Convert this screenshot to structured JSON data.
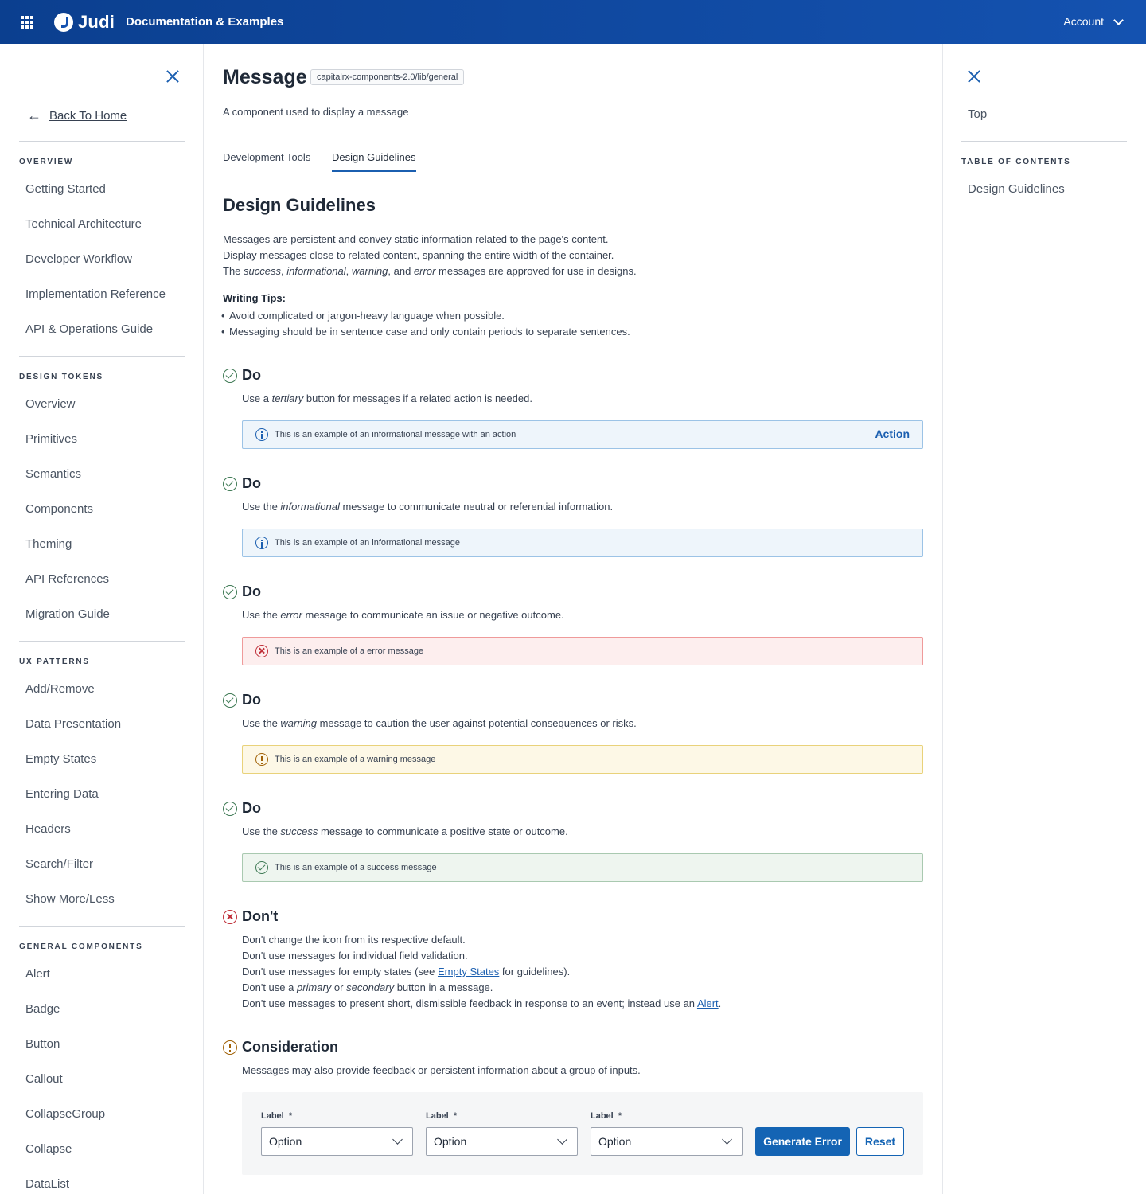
{
  "header": {
    "logo_text": "Judi",
    "app_title": "Documentation & Examples",
    "account_label": "Account"
  },
  "sidebar": {
    "back_label": "Back To Home",
    "sections": [
      {
        "title": "OVERVIEW",
        "items": [
          "Getting Started",
          "Technical Architecture",
          "Developer Workflow",
          "Implementation Reference",
          "API & Operations Guide"
        ]
      },
      {
        "title": "DESIGN TOKENS",
        "items": [
          "Overview",
          "Primitives",
          "Semantics",
          "Components",
          "Theming",
          "API References",
          "Migration Guide"
        ]
      },
      {
        "title": "UX PATTERNS",
        "items": [
          "Add/Remove",
          "Data Presentation",
          "Empty States",
          "Entering Data",
          "Headers",
          "Search/Filter",
          "Show More/Less"
        ]
      },
      {
        "title": "GENERAL COMPONENTS",
        "items": [
          "Alert",
          "Badge",
          "Button",
          "Callout",
          "CollapseGroup",
          "Collapse",
          "DataList"
        ]
      }
    ]
  },
  "page": {
    "title": "Message",
    "path_badge": "capitalrx-components-2.0/lib/general",
    "description": "A component used to display a message",
    "tabs": [
      "Development Tools",
      "Design Guidelines"
    ],
    "active_tab": "Design Guidelines"
  },
  "guidelines": {
    "heading": "Design Guidelines",
    "intro_line1": "Messages are persistent and convey static information related to the page's content.",
    "intro_line2": "Display messages close to related content, spanning the entire width of the container.",
    "intro_line3_prefix": "The ",
    "intro_line3_success": "success",
    "intro_line3_sep1": ", ",
    "intro_line3_info": "informational",
    "intro_line3_sep2": ", ",
    "intro_line3_warning": "warning",
    "intro_line3_sep3": ", and ",
    "intro_line3_error": "error",
    "intro_line3_suffix": " messages are approved for use in designs.",
    "tips_title": "Writing Tips:",
    "tips": [
      "Avoid complicated or jargon-heavy language when possible.",
      "Messaging should be in sentence case and only contain periods to separate sentences."
    ],
    "do_label": "Do",
    "dos": [
      {
        "pre": "Use a ",
        "em": "tertiary",
        "post": " button for messages if a related action is needed.",
        "message": "This is an example of an informational message with an action",
        "action": "Action"
      },
      {
        "pre": "Use the ",
        "em": "informational",
        "post": " message to communicate neutral or referential information.",
        "message": "This is an example of an informational message"
      },
      {
        "pre": "Use the ",
        "em": "error",
        "post": " message to communicate an issue or negative outcome.",
        "message": "This is an example of a error message"
      },
      {
        "pre": "Use the ",
        "em": "warning",
        "post": " message to caution the user against potential consequences or risks.",
        "message": "This is an example of a warning message"
      },
      {
        "pre": "Use the ",
        "em": "success",
        "post": " message to communicate a positive state or outcome.",
        "message": "This is an example of a success message"
      }
    ],
    "dont_label": "Don't",
    "donts": {
      "line1": "Don't change the icon from its respective default.",
      "line2": "Don't use messages for individual field validation.",
      "line3_pre": "Don't use messages for empty states (see ",
      "line3_link": "Empty States",
      "line3_post": " for guidelines).",
      "line4_pre": "Don't use a ",
      "line4_em1": "primary",
      "line4_mid": " or ",
      "line4_em2": "secondary",
      "line4_post": " button in a message.",
      "line5_pre": "Don't use messages to present short, dismissible feedback in response to an event; instead use an ",
      "line5_link": "Alert",
      "line5_post": "."
    },
    "consideration_label": "Consideration",
    "consideration_desc": "Messages may also provide feedback or persistent information about a group of inputs.",
    "demo": {
      "field_label": "Label",
      "required_mark": "*",
      "select_value": "Option",
      "generate_label": "Generate Error",
      "reset_label": "Reset"
    }
  },
  "toc": {
    "top_label": "Top",
    "title": "TABLE OF CONTENTS",
    "items": [
      "Design Guidelines"
    ]
  },
  "colors": {
    "header_bg": "#1452b0",
    "accent": "#1b5fb0",
    "success": "#3f7a55",
    "error": "#c0303a",
    "warning": "#a16207"
  }
}
